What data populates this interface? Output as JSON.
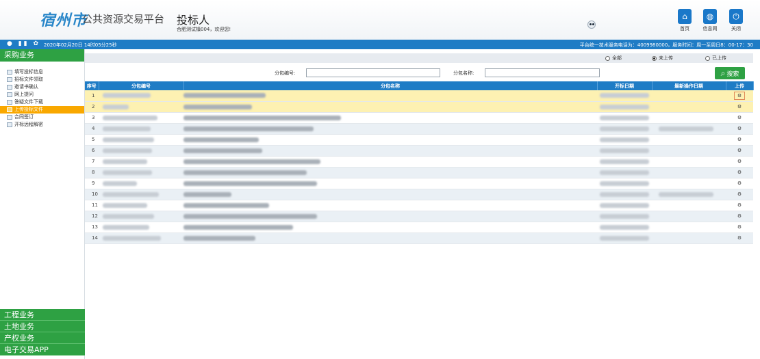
{
  "header": {
    "city": "宿州市",
    "platform": "公共资源交易平台",
    "role": "投标人",
    "welcome": "合肥测试镇004，欢迎您!",
    "buttons": [
      {
        "label": "首页",
        "icon": "home-icon"
      },
      {
        "label": "信息网",
        "icon": "globe-icon"
      },
      {
        "label": "关闭",
        "icon": "power-icon"
      }
    ]
  },
  "bluebar": {
    "datetime": "2020年02月20日 14时05分25秒",
    "info": "平台统一技术服务电话为：4009980000，服务时间：周一至周日8：00-17：30"
  },
  "sidebar": {
    "section": "采购业务",
    "items": [
      {
        "label": "填写投标信息"
      },
      {
        "label": "招标文件领取"
      },
      {
        "label": "邀请书确认"
      },
      {
        "label": "网上提问"
      },
      {
        "label": "答疑文件下载"
      },
      {
        "label": "上传投标文件",
        "active": true
      },
      {
        "label": "合同签订"
      },
      {
        "label": "开标远程解密"
      }
    ],
    "bottom": [
      "工程业务",
      "土地业务",
      "产权业务",
      "电子交易APP"
    ]
  },
  "filters": {
    "all": "全部",
    "not_uploaded": "未上传",
    "uploaded": "已上传",
    "selected": "not_uploaded"
  },
  "search": {
    "pkg_no_label": "分包编号:",
    "pkg_name_label": "分包名称:",
    "pkg_no_value": "",
    "pkg_name_value": "",
    "button": "搜索"
  },
  "table": {
    "headers": [
      "序号",
      "分包编号",
      "分包名称",
      "开标日期",
      "最新操作日期",
      "上传"
    ],
    "rows": [
      {
        "no": "1"
      },
      {
        "no": "2"
      },
      {
        "no": "3"
      },
      {
        "no": "4"
      },
      {
        "no": "5"
      },
      {
        "no": "6"
      },
      {
        "no": "7"
      },
      {
        "no": "8"
      },
      {
        "no": "9"
      },
      {
        "no": "10"
      },
      {
        "no": "11"
      },
      {
        "no": "12"
      },
      {
        "no": "13"
      },
      {
        "no": "14"
      }
    ],
    "upload_icon": "gear-icon"
  },
  "colors": {
    "brand_blue": "#1f7cc5",
    "menu_green": "#2ea143",
    "active_orange": "#f9a800",
    "highlight_row": "#fdf1b2"
  }
}
